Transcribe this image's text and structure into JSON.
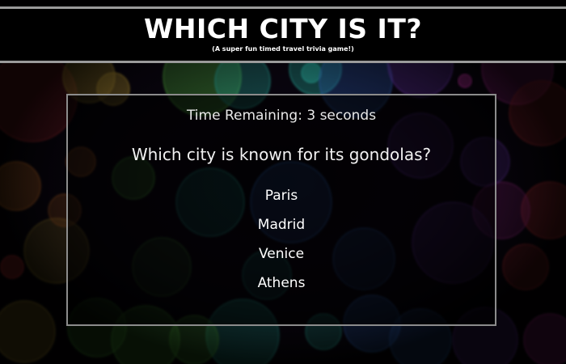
{
  "header": {
    "title": "WHICH CITY IS IT?",
    "subtitle": "(A super fun timed travel trivia game!)"
  },
  "quiz": {
    "timer": "Time Remaining: 3 seconds",
    "question": "Which city is known for its gondolas?",
    "answers": [
      "Paris",
      "Madrid",
      "Venice",
      "Athens"
    ]
  },
  "colors": {
    "header_background": "#000000",
    "header_border": "#9a9a9a",
    "panel_border": "#8c8c8c",
    "text": "#ffffff",
    "bokeh_palette": [
      "#ff3b3b",
      "#ff8a2a",
      "#ffd23a",
      "#6cff4a",
      "#2ee6c8",
      "#3a8bff",
      "#9b4bff",
      "#ff3ad1"
    ]
  },
  "background": {
    "style": "colorful bokeh lights"
  }
}
